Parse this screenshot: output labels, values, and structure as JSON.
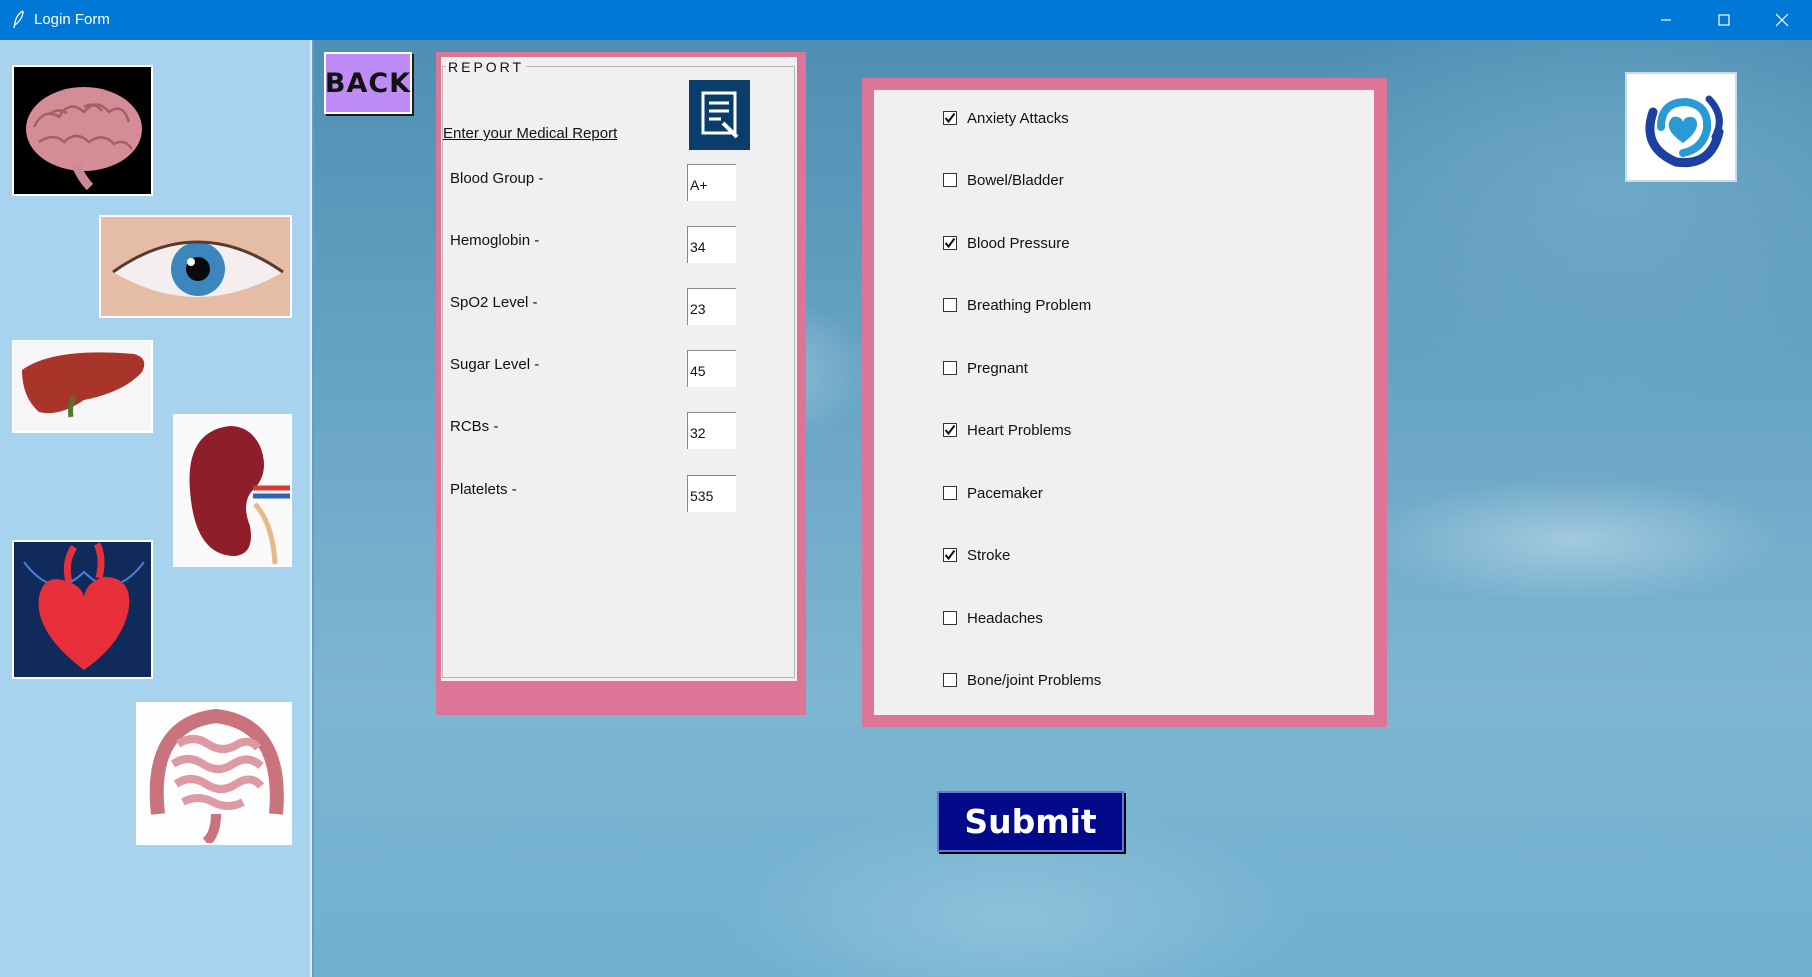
{
  "window": {
    "title": "Login Form",
    "icon": "feather-icon",
    "controls": [
      "minimize-icon",
      "maximize-icon",
      "close-icon"
    ]
  },
  "sidebar": {
    "images": [
      "brain",
      "eye",
      "liver",
      "kidney",
      "heart",
      "intestines"
    ]
  },
  "back_button": {
    "label": "BACK"
  },
  "report": {
    "legend": "REPORT",
    "heading": "Enter your Medical Report",
    "icon": "report-document-icon",
    "fields": [
      {
        "label": "Blood Group -",
        "value": "A+"
      },
      {
        "label": "Hemoglobin -",
        "value": "34"
      },
      {
        "label": "SpO2 Level -",
        "value": "23"
      },
      {
        "label": "Sugar Level -",
        "value": "45"
      },
      {
        "label": "RCBs -",
        "value": "32"
      },
      {
        "label": "Platelets -",
        "value": "535"
      }
    ]
  },
  "conditions": [
    {
      "label": "Anxiety Attacks",
      "checked": true
    },
    {
      "label": "Bowel/Bladder",
      "checked": false
    },
    {
      "label": "Blood Pressure",
      "checked": true
    },
    {
      "label": "Breathing Problem",
      "checked": false
    },
    {
      "label": "Pregnant",
      "checked": false
    },
    {
      "label": "Heart Problems",
      "checked": true
    },
    {
      "label": "Pacemaker",
      "checked": false
    },
    {
      "label": "Stroke",
      "checked": true
    },
    {
      "label": "Headaches",
      "checked": false
    },
    {
      "label": "Bone/joint Problems",
      "checked": false
    }
  ],
  "logo": "heart-in-hands-logo",
  "submit_button": {
    "label": "Submit"
  },
  "colors": {
    "titlebar": "#0078d7",
    "sidebar": "#a7d3ee",
    "panel_border": "#dc7597",
    "back_button": "#bf8cf5",
    "submit_button": "#020a8a"
  }
}
